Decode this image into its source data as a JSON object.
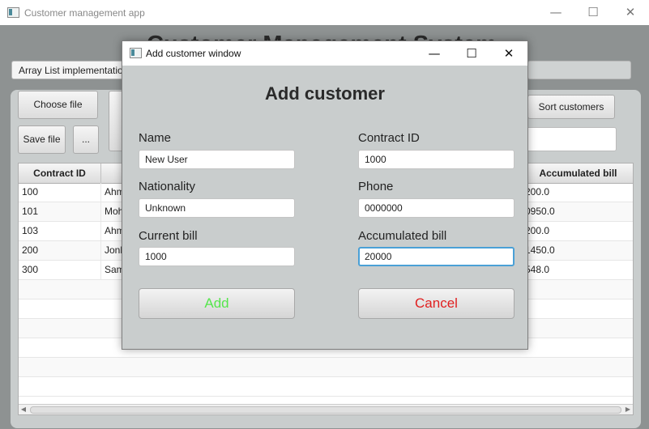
{
  "main_window": {
    "title": "Customer management app",
    "heading": "Customer Management System",
    "implementation_select": "Array List implementation",
    "buttons": {
      "choose_file": "Choose file",
      "save_file": "Save file",
      "more": "...",
      "sort_customers": "Sort customers"
    },
    "table": {
      "headers": [
        "Contract ID",
        "",
        "",
        "",
        "",
        "Accumulated bill"
      ],
      "rows": [
        {
          "contract_id": "100",
          "name": "Ahm",
          "accumulated": "200.0"
        },
        {
          "contract_id": "101",
          "name": "Moh",
          "accumulated": "0950.0"
        },
        {
          "contract_id": "103",
          "name": "Ahm",
          "accumulated": "200.0"
        },
        {
          "contract_id": "200",
          "name": "Jonh",
          "accumulated": "1450.0"
        },
        {
          "contract_id": "300",
          "name": "Sam",
          "accumulated": "548.0"
        }
      ]
    }
  },
  "dialog": {
    "title": "Add customer window",
    "heading": "Add customer",
    "fields": {
      "name": {
        "label": "Name",
        "value": "New User"
      },
      "contract_id": {
        "label": "Contract ID",
        "value": "1000"
      },
      "nationality": {
        "label": "Nationality",
        "value": "Unknown"
      },
      "phone": {
        "label": "Phone",
        "value": "0000000"
      },
      "current_bill": {
        "label": "Current bill",
        "value": "1000"
      },
      "accumulated_bill": {
        "label": "Accumulated bill",
        "value": "20000"
      }
    },
    "add_label": "Add",
    "cancel_label": "Cancel",
    "colors": {
      "add": "#55e64c",
      "cancel": "#e02020"
    }
  },
  "window_controls": {
    "minimize": "—",
    "maximize": "☐",
    "close": "✕"
  }
}
